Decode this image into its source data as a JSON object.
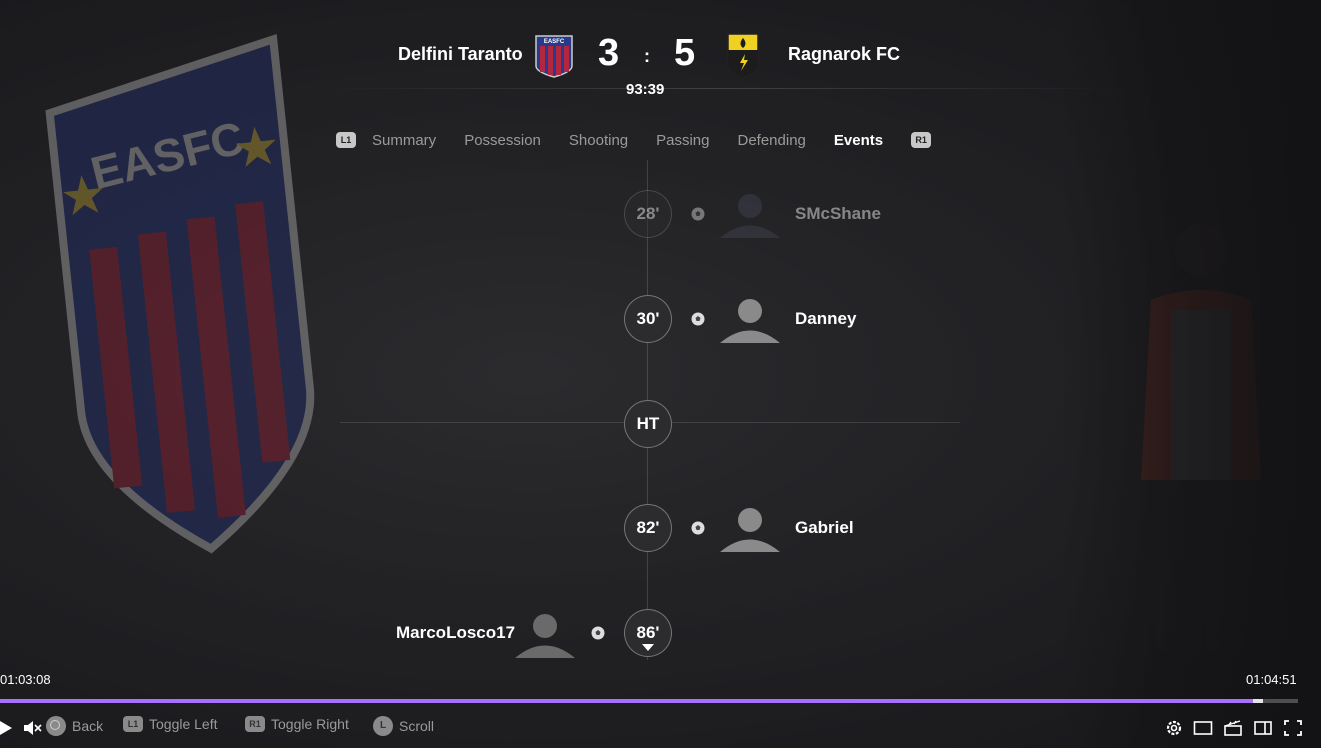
{
  "match": {
    "home_team": "Delfini Taranto",
    "away_team": "Ragnarok FC",
    "home_score": "3",
    "separator": ":",
    "away_score": "5",
    "clock": "93:39",
    "home_badge_text": "EASFC"
  },
  "tabs": {
    "left_button": "L1",
    "right_button": "R1",
    "items": [
      "Summary",
      "Possession",
      "Shooting",
      "Passing",
      "Defending",
      "Events"
    ],
    "active": "Events"
  },
  "events": [
    {
      "minute": "28'",
      "player": "SMcShane",
      "side": "away"
    },
    {
      "minute": "30'",
      "player": "Danney",
      "side": "away"
    },
    {
      "minute": "HT",
      "player": "",
      "side": "center"
    },
    {
      "minute": "82'",
      "player": "Gabriel",
      "side": "away"
    },
    {
      "minute": "86'",
      "player": "MarcoLosco17",
      "side": "home"
    }
  ],
  "player": {
    "current_time": "01:03:08",
    "duration": "01:04:51",
    "progress": 0.973
  },
  "controls": {
    "back_button": "",
    "back_label": "Back",
    "toggle_left_button": "L1",
    "toggle_left_label": "Toggle Left",
    "toggle_right_button": "R1",
    "toggle_right_label": "Toggle Right",
    "scroll_button": "L",
    "scroll_label": "Scroll"
  },
  "background_crest_text": "EASFC",
  "colors": {
    "accent": "#a970ff",
    "crest_red": "#b3263f",
    "crest_blue": "#2a3a8a",
    "away_yellow": "#f0d020"
  }
}
